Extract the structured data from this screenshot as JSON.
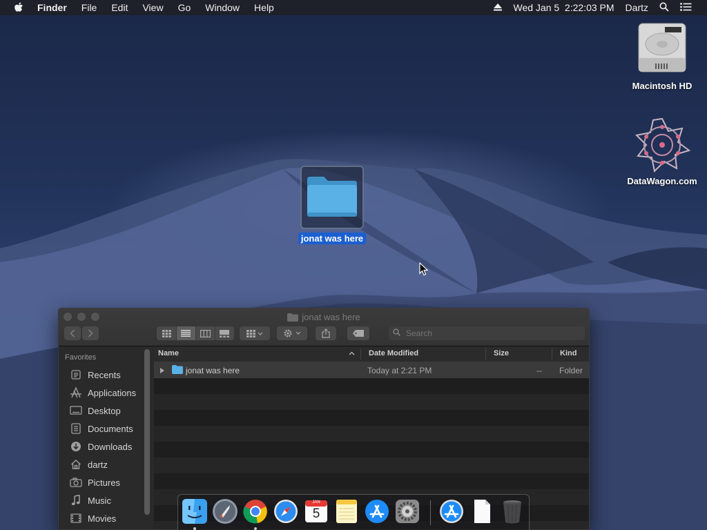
{
  "menubar": {
    "items": [
      "Finder",
      "File",
      "Edit",
      "View",
      "Go",
      "Window",
      "Help"
    ],
    "clock": "Wed Jan 5  2:22:03 PM",
    "user": "Dartz"
  },
  "desktop": {
    "icons": [
      {
        "label": "Macintosh HD",
        "icon": "hard-drive-icon"
      },
      {
        "label": "DataWagon.com",
        "icon": "network-drive-icon"
      },
      {
        "label": "jonat was here",
        "icon": "folder-icon",
        "selected": true
      }
    ]
  },
  "finder": {
    "title": "jonat was here",
    "search_placeholder": "Search",
    "sidebar": {
      "section": "Favorites",
      "items": [
        {
          "label": "Recents",
          "icon": "recents-icon"
        },
        {
          "label": "Applications",
          "icon": "applications-icon"
        },
        {
          "label": "Desktop",
          "icon": "desktop-icon"
        },
        {
          "label": "Documents",
          "icon": "documents-icon"
        },
        {
          "label": "Downloads",
          "icon": "downloads-icon"
        },
        {
          "label": "dartz",
          "icon": "home-icon"
        },
        {
          "label": "Pictures",
          "icon": "pictures-icon"
        },
        {
          "label": "Music",
          "icon": "music-icon"
        },
        {
          "label": "Movies",
          "icon": "movies-icon"
        }
      ]
    },
    "columns": [
      "Name",
      "Date Modified",
      "Size",
      "Kind"
    ],
    "rows": [
      {
        "name": "jonat was here",
        "date": "Today at 2:21 PM",
        "size": "--",
        "kind": "Folder"
      }
    ]
  },
  "dock": {
    "apps": [
      "finder-icon",
      "launchpad-icon",
      "chrome-icon",
      "safari-icon",
      "calendar-icon",
      "notes-icon",
      "app-store-icon",
      "system-preferences-icon",
      "downloads-stack-icon",
      "document-icon",
      "trash-icon"
    ],
    "calendar": {
      "month": "JAN",
      "day": "5"
    }
  },
  "colors": {
    "selection": "#1b5fd1",
    "folder": "#5ab1e6"
  }
}
